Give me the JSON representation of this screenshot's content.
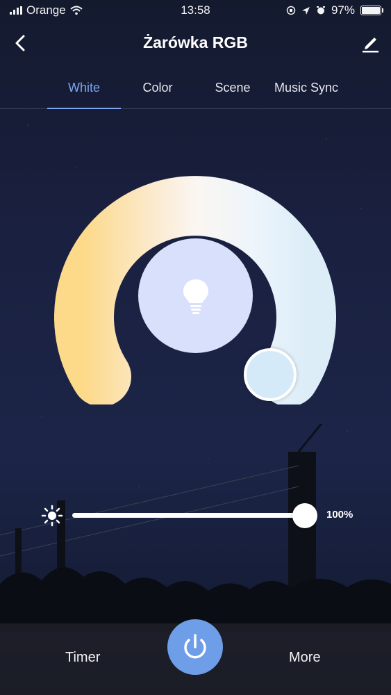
{
  "status_bar": {
    "carrier": "Orange",
    "time": "13:58",
    "battery": "97%"
  },
  "header": {
    "title": "Żarówka RGB",
    "back_icon": "chevron-left-icon",
    "edit_icon": "pencil-icon"
  },
  "tabs": [
    {
      "label": "White",
      "active": true
    },
    {
      "label": "Color",
      "active": false
    },
    {
      "label": "Scene",
      "active": false
    },
    {
      "label": "Music Sync",
      "active": false
    }
  ],
  "color_wheel": {
    "warm_color": "#fdd98a",
    "cool_color": "#dcedf8",
    "center_color": "#d9e0fb",
    "center_icon": "lightbulb-icon"
  },
  "brightness": {
    "icon": "sun-icon",
    "value": 100,
    "label": "100%"
  },
  "bottom_bar": {
    "timer_label": "Timer",
    "more_label": "More",
    "power_icon": "power-icon",
    "power_color": "#6e9ee8"
  },
  "colors": {
    "accent": "#7ca6ef"
  }
}
